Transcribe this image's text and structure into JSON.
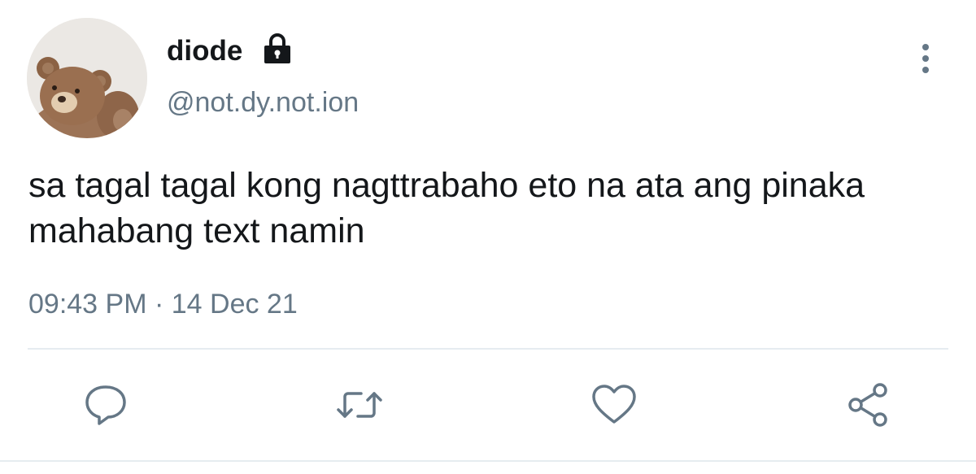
{
  "user": {
    "display_name": "diode",
    "handle": "@not.dy.not.ion",
    "avatar": "teddy-bear-avatar",
    "protected_icon": "lock-icon"
  },
  "tweet": {
    "text": "sa tagal tagal kong nagttrabaho eto na ata ang pinaka mahabang text namin",
    "timestamp": "09:43 PM · 14 Dec 21"
  },
  "menu": {
    "icon": "more-vertical-icon"
  },
  "actions": [
    {
      "name": "reply",
      "icon": "reply-icon"
    },
    {
      "name": "retweet",
      "icon": "retweet-icon"
    },
    {
      "name": "like",
      "icon": "heart-icon"
    },
    {
      "name": "share",
      "icon": "share-icon"
    }
  ],
  "colors": {
    "text_primary": "#14171a",
    "text_secondary": "#657786",
    "divider": "#e6ecf0"
  }
}
